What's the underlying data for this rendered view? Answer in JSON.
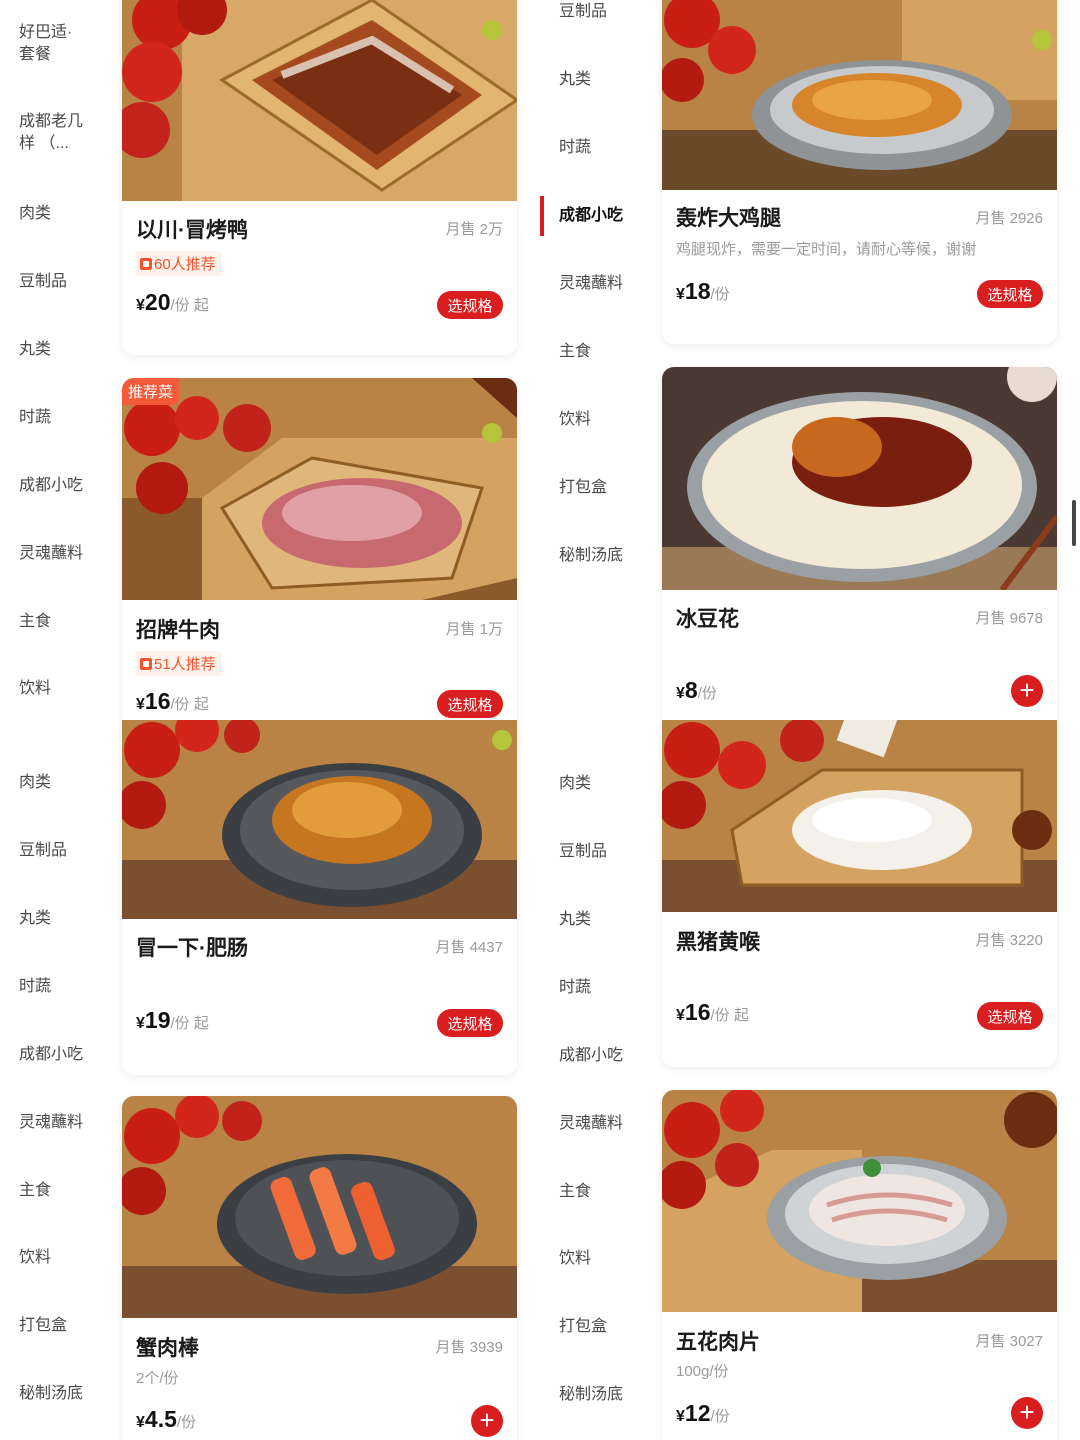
{
  "panels": [
    {
      "sidebar": [
        {
          "label": "好巴适·\n套餐"
        },
        {
          "label": "成都老几\n样 （..."
        },
        {
          "label": "肉类"
        },
        {
          "label": "豆制品"
        },
        {
          "label": "丸类"
        },
        {
          "label": "时蔬"
        },
        {
          "label": "成都小吃"
        },
        {
          "label": "灵魂蘸料"
        },
        {
          "label": "主食"
        },
        {
          "label": "饮料"
        }
      ],
      "cards": [
        {
          "name": "以川·冒烤鸭",
          "sales": "月售 2万",
          "recommend": "60人推荐",
          "yen": "¥",
          "price": "20",
          "unit": "/份 起",
          "button": "选规格",
          "photo": "roast-duck"
        },
        {
          "name": "招牌牛肉",
          "sales": "月售 1万",
          "recommend": "51人推荐",
          "yen": "¥",
          "price": "16",
          "unit": "/份 起",
          "button": "选规格",
          "badge": "推荐菜",
          "photo": "beef"
        }
      ]
    },
    {
      "sidebar": [
        {
          "label": "豆制品"
        },
        {
          "label": "丸类"
        },
        {
          "label": "时蔬"
        },
        {
          "label": "成都小吃",
          "active": true
        },
        {
          "label": "灵魂蘸料"
        },
        {
          "label": "主食"
        },
        {
          "label": "饮料"
        },
        {
          "label": "打包盒"
        },
        {
          "label": "秘制汤底"
        }
      ],
      "cards": [
        {
          "name": "轰炸大鸡腿",
          "sales": "月售 2926",
          "desc": "鸡腿现炸，需要一定时间，请耐心等候，谢谢",
          "yen": "¥",
          "price": "18",
          "unit": "/份",
          "button": "选规格",
          "photo": "chicken"
        },
        {
          "name": "冰豆花",
          "sales": "月售 9678",
          "yen": "¥",
          "price": "8",
          "unit": "/份",
          "add": "+",
          "photo": "tofu-pudding"
        }
      ]
    },
    {
      "sidebar": [
        {
          "label": "肉类"
        },
        {
          "label": "豆制品"
        },
        {
          "label": "丸类"
        },
        {
          "label": "时蔬"
        },
        {
          "label": "成都小吃"
        },
        {
          "label": "灵魂蘸料"
        },
        {
          "label": "主食"
        },
        {
          "label": "饮料"
        },
        {
          "label": "打包盒"
        },
        {
          "label": "秘制汤底"
        }
      ],
      "cards": [
        {
          "name": "冒一下·肥肠",
          "sales": "月售 4437",
          "yen": "¥",
          "price": "19",
          "unit": "/份 起",
          "button": "选规格",
          "photo": "intestine"
        },
        {
          "name": "蟹肉棒",
          "sales": "月售 3939",
          "desc": "2个/份",
          "yen": "¥",
          "price": "4.5",
          "unit": "/份",
          "add": "+",
          "photo": "crab-sticks"
        }
      ]
    },
    {
      "sidebar": [
        {
          "label": "肉类"
        },
        {
          "label": "豆制品"
        },
        {
          "label": "丸类"
        },
        {
          "label": "时蔬"
        },
        {
          "label": "成都小吃"
        },
        {
          "label": "灵魂蘸料"
        },
        {
          "label": "主食"
        },
        {
          "label": "饮料"
        },
        {
          "label": "打包盒"
        },
        {
          "label": "秘制汤底"
        }
      ],
      "cards": [
        {
          "name": "黑猪黄喉",
          "sales": "月售 3220",
          "yen": "¥",
          "price": "16",
          "unit": "/份 起",
          "button": "选规格",
          "photo": "aorta"
        },
        {
          "name": "五花肉片",
          "sales": "月售 3027",
          "desc": "100g/份",
          "yen": "¥",
          "price": "12",
          "unit": "/份",
          "add": "+",
          "photo": "pork-belly"
        }
      ]
    }
  ],
  "colors": {
    "accent": "#d81e1e",
    "recommend": "#f0562c",
    "muted": "#9a9a9a"
  }
}
